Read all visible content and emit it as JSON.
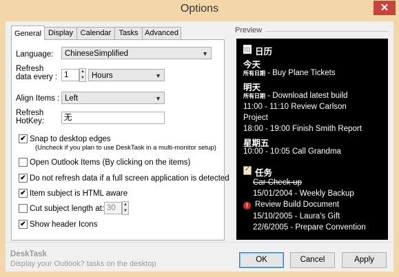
{
  "window": {
    "title": "Options",
    "close_glyph": "✕"
  },
  "tabs": [
    {
      "label": "General",
      "active": true
    },
    {
      "label": "Display"
    },
    {
      "label": "Calendar"
    },
    {
      "label": "Tasks"
    },
    {
      "label": "Advanced"
    }
  ],
  "general": {
    "language_label": "Language:",
    "language_value": "ChineseSimplified",
    "refresh_label_1": "Refresh",
    "refresh_label_2": "data every :",
    "refresh_value": "1",
    "refresh_unit": "Hours",
    "align_label": "Align Items :",
    "align_value": "Left",
    "hotkey_label_1": "Refresh",
    "hotkey_label_2": "HotKey:",
    "hotkey_value": "无",
    "snap_label": "Snap to desktop edges",
    "snap_checked": true,
    "snap_hint": "(Uncheck if you plan to use DeskTask in a multi-monitor setup)",
    "open_outlook_label": "Open Outlook Items (By clicking on the items)",
    "open_outlook_checked": false,
    "no_refresh_label": "Do not refresh data if a full screen application is detected",
    "no_refresh_checked": true,
    "html_aware_label": "Item subject is HTML aware",
    "html_aware_checked": true,
    "cut_subject_label": "Cut subject length at:",
    "cut_subject_checked": false,
    "cut_subject_value": "30",
    "header_icons_label": "Show header Icons",
    "header_icons_checked": true
  },
  "preview": {
    "label": "Preview",
    "calendar_header": "日历",
    "day1": "今天",
    "day1_small": "所有日期",
    "day1_item": " - Buy Plane Tickets",
    "day2": "明天",
    "day2_small": "所有日期",
    "day2_item1": " - Download latest build",
    "day2_item2": "11:00 - 11:10 Review Carlson",
    "day2_item2b": "Project",
    "day2_item3": "18:00 - 19:00 Finish Smith Report",
    "day3": "星期五",
    "day3_item1": "10:00 - 10:05 Call Grandma",
    "tasks_header": "任务",
    "task1": "Car Check-up",
    "task2": "15/01/2004 - Weekly Backup",
    "task3": "Review Build Document",
    "task4": "15/10/2005 - Laura's Gift",
    "task5": "22/6/2005 - Prepare Convention"
  },
  "footer": {
    "app_name": "DeskTask",
    "app_desc": "Display your Outlook? tasks on the desktop",
    "ok_label": "OK",
    "cancel_label": "Cancel",
    "apply_label": "Apply"
  },
  "colors": {
    "frame": "#f4d6ab",
    "close": "#c8433c",
    "preview_bg": "#000000"
  }
}
